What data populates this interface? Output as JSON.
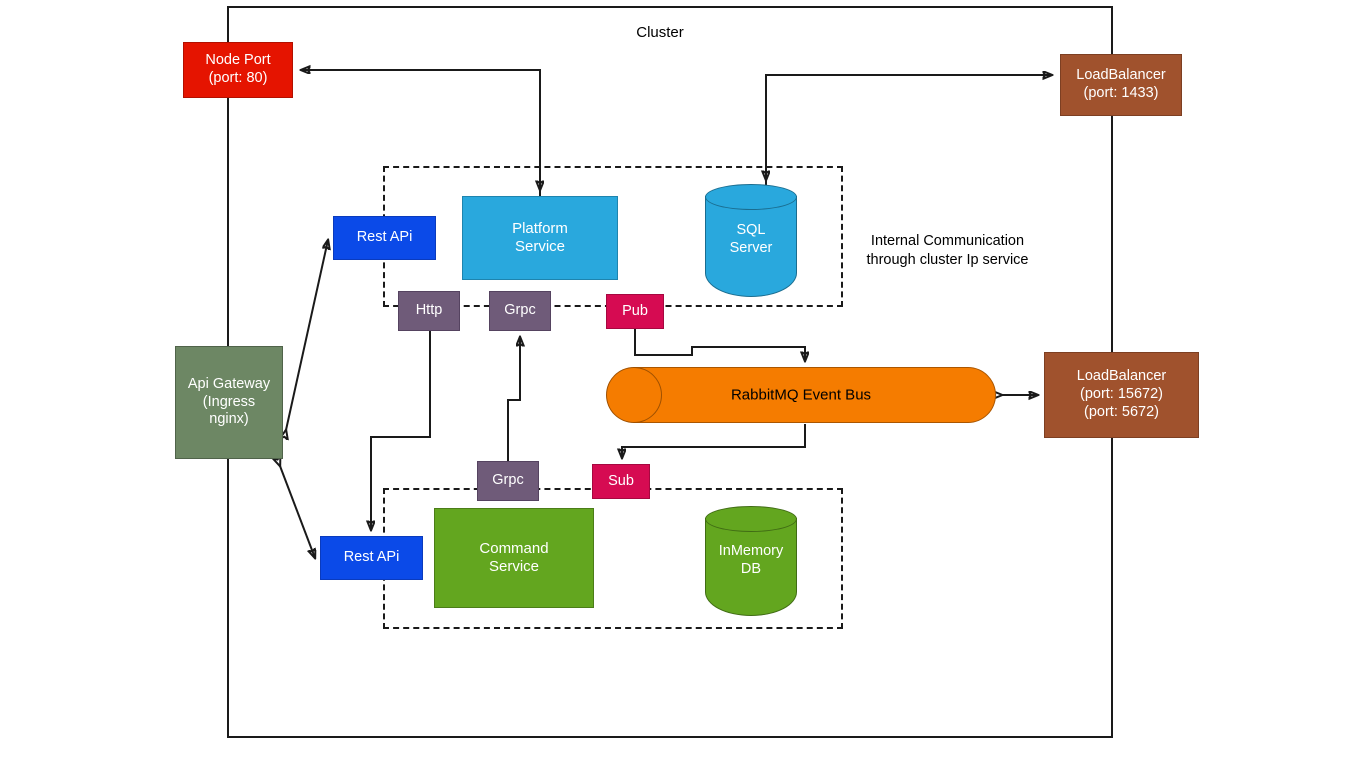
{
  "diagram": {
    "cluster_label": "Cluster",
    "note": {
      "line1": "Internal",
      "line2": "Communication",
      "line3": "through cluster",
      "line4": "Ip service"
    },
    "colors": {
      "node_port": "#e51400",
      "load_balancer": "#a0522d",
      "api_gateway": "#6d8764",
      "rest_api": "#0b4ae8",
      "platform_service": "#29a8dd",
      "command_service": "#63a61f",
      "protocol_tag": "#6f5b79",
      "pubsub_tag": "#d60b52",
      "event_bus": "#f57c00",
      "sql_server": "#29a8dd",
      "inmemory_db": "#63a61f",
      "stroke": "#1a1a1a"
    },
    "nodes": {
      "node_port": {
        "line1": "Node Port",
        "line2": "(port: 80)"
      },
      "load_balancer_sql": {
        "line1": "LoadBalancer",
        "line2": "(port: 1433)"
      },
      "load_balancer_rabbit": {
        "line1": "LoadBalancer",
        "line2": "(port: 15672)",
        "line3": "(port: 5672)"
      },
      "api_gateway": {
        "line1": "Api Gateway",
        "line2": "(Ingress",
        "line3": "nginx)"
      },
      "rest_api_top": {
        "label": "Rest APi"
      },
      "rest_api_bottom": {
        "label": "Rest APi"
      },
      "platform_service": {
        "line1": "Platform",
        "line2": "Service"
      },
      "command_service": {
        "line1": "Command",
        "line2": "Service"
      },
      "sql_server": {
        "line1": "SQL",
        "line2": "Server"
      },
      "inmemory_db": {
        "line1": "InMemory",
        "line2": "DB"
      },
      "event_bus": {
        "label": "RabbitMQ Event Bus"
      },
      "http_tag": {
        "label": "Http"
      },
      "grpc_tag_top": {
        "label": "Grpc"
      },
      "grpc_tag_bottom": {
        "label": "Grpc"
      },
      "pub_tag": {
        "label": "Pub"
      },
      "sub_tag": {
        "label": "Sub"
      }
    },
    "connections": [
      {
        "from": "platform_service",
        "to": "node_port",
        "arrow": "single"
      },
      {
        "from": "sql_server",
        "to": "load_balancer_sql",
        "arrow": "single"
      },
      {
        "from": "api_gateway",
        "to": "rest_api_top",
        "arrow": "double"
      },
      {
        "from": "api_gateway",
        "to": "rest_api_bottom",
        "arrow": "double"
      },
      {
        "from": "http_tag",
        "to": "rest_api_bottom",
        "arrow": "single"
      },
      {
        "from": "grpc_tag_bottom",
        "to": "grpc_tag_top",
        "arrow": "single"
      },
      {
        "from": "pub_tag",
        "to": "event_bus",
        "arrow": "single"
      },
      {
        "from": "event_bus",
        "to": "sub_tag",
        "arrow": "single"
      },
      {
        "from": "event_bus",
        "to": "load_balancer_rabbit",
        "arrow": "double"
      }
    ]
  }
}
